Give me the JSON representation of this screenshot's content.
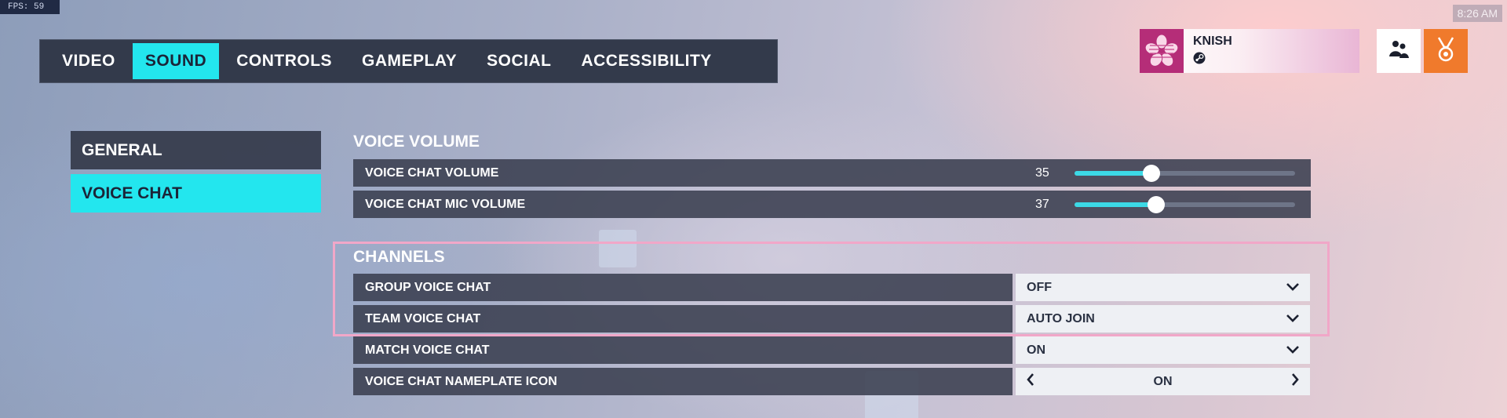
{
  "fps": "FPS:  59",
  "clock": "8:26 AM",
  "tabs": [
    {
      "label": "VIDEO",
      "active": false
    },
    {
      "label": "SOUND",
      "active": true
    },
    {
      "label": "CONTROLS",
      "active": false
    },
    {
      "label": "GAMEPLAY",
      "active": false
    },
    {
      "label": "SOCIAL",
      "active": false
    },
    {
      "label": "ACCESSIBILITY",
      "active": false
    }
  ],
  "profile": {
    "name": "KNISH",
    "avatar_icon": "sakura-flower-icon",
    "platform_icon": "steam-icon"
  },
  "header_buttons": [
    {
      "icon": "social-group-icon",
      "bg": "#ffffff"
    },
    {
      "icon": "challenges-medal-icon",
      "bg": "#f07a2c"
    }
  ],
  "sidebar": [
    {
      "label": "GENERAL",
      "active": false
    },
    {
      "label": "VOICE CHAT",
      "active": true
    }
  ],
  "voice_volume": {
    "title": "VOICE VOLUME",
    "rows": [
      {
        "label": "VOICE CHAT VOLUME",
        "value": "35",
        "level": 0.35
      },
      {
        "label": "VOICE CHAT MIC VOLUME",
        "value": "37",
        "level": 0.37
      }
    ]
  },
  "channels": {
    "title": "CHANNELS",
    "rows": [
      {
        "label": "GROUP VOICE CHAT",
        "value": "OFF"
      },
      {
        "label": "TEAM VOICE CHAT",
        "value": "AUTO JOIN"
      },
      {
        "label": "MATCH VOICE CHAT",
        "value": "ON"
      },
      {
        "label": "VOICE CHAT NAMEPLATE ICON",
        "value": "ON"
      }
    ]
  },
  "colors": {
    "accent": "#23e6ee",
    "highlight_border": "#f1a7c8",
    "row_bg": "#3a3f50",
    "orange": "#f07a2c"
  }
}
